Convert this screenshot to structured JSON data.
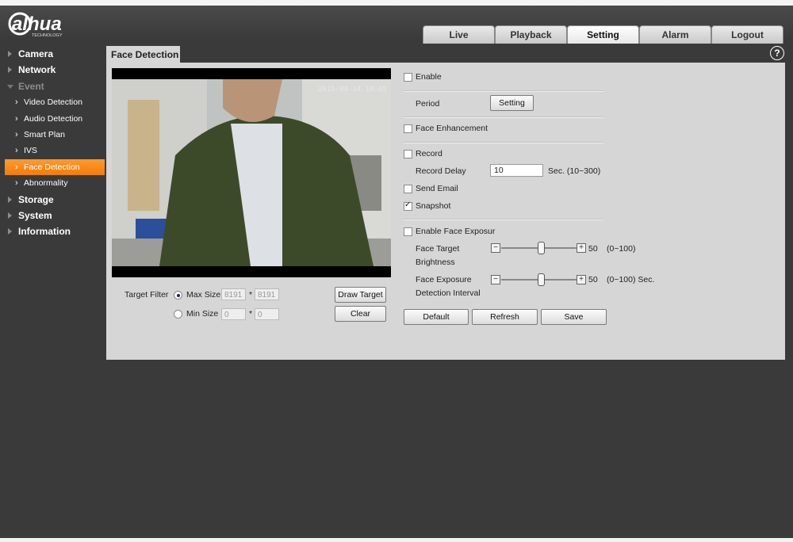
{
  "brand": {
    "name": "alhua",
    "tagline": "TECHNOLOGY"
  },
  "nav": {
    "tabs": [
      "Live",
      "Playback",
      "Setting",
      "Alarm",
      "Logout"
    ],
    "active": "Setting"
  },
  "sidebar": [
    {
      "label": "Camera",
      "level": 0
    },
    {
      "label": "Network",
      "level": 0
    },
    {
      "label": "Event",
      "level": 0,
      "expanded": true
    },
    {
      "label": "Video Detection",
      "level": 1
    },
    {
      "label": "Audio Detection",
      "level": 1
    },
    {
      "label": "Smart Plan",
      "level": 1
    },
    {
      "label": "IVS",
      "level": 1
    },
    {
      "label": "Face Detection",
      "level": 1,
      "active": true
    },
    {
      "label": "Abnormality",
      "level": 1
    },
    {
      "label": "Storage",
      "level": 0
    },
    {
      "label": "System",
      "level": 0
    },
    {
      "label": "Information",
      "level": 0
    }
  ],
  "page": {
    "title": "Face Detection",
    "help_icon": "?"
  },
  "video": {
    "timestamp": "2015-04-14 10:05"
  },
  "target_filter": {
    "label": "Target Filter",
    "max_label": "Max Size",
    "max_w": "8191",
    "max_h": "8191",
    "max_selected": true,
    "min_label": "Min Size",
    "min_w": "0",
    "min_h": "0",
    "sep": "*",
    "draw_button": "Draw Target",
    "clear_button": "Clear"
  },
  "settings": {
    "enable": {
      "label": "Enable",
      "checked": false
    },
    "period": {
      "label": "Period",
      "button": "Setting"
    },
    "face_enhancement": {
      "label": "Face Enhancement",
      "checked": false
    },
    "record": {
      "label": "Record",
      "checked": false
    },
    "record_delay": {
      "label": "Record Delay",
      "value": "10",
      "hint": "Sec. (10~300)"
    },
    "send_email": {
      "label": "Send Email",
      "checked": false
    },
    "snapshot": {
      "label": "Snapshot",
      "checked": true
    },
    "face_exposure": {
      "label": "Enable Face Exposur",
      "checked": false
    },
    "brightness": {
      "label1": "Face Target",
      "label2": "Brightness",
      "value": "50",
      "range": "(0~100)",
      "fraction": 0.5,
      "minus": "−",
      "plus": "+"
    },
    "interval": {
      "label1": "Face Exposure",
      "label2": "Detection Interval",
      "value": "50",
      "range": "(0~100) Sec.",
      "fraction": 0.5,
      "minus": "−",
      "plus": "+"
    }
  },
  "actions": {
    "default": "Default",
    "refresh": "Refresh",
    "save": "Save"
  },
  "colors": {
    "accent": "#f07d0a",
    "background": "#3a3a3a",
    "panel": "#d6d6d6"
  }
}
